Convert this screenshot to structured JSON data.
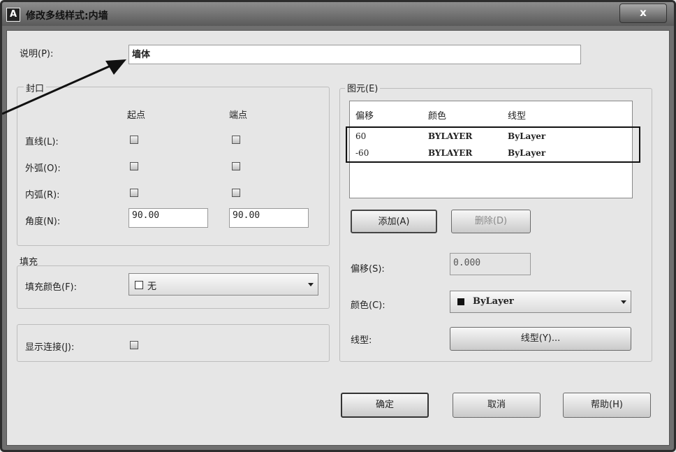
{
  "window": {
    "title": "修改多线样式:内墙",
    "close_label": "x"
  },
  "description": {
    "label": "说明(P):",
    "value": "墙体"
  },
  "caps": {
    "title": "封口",
    "col_start": "起点",
    "col_end": "端点",
    "rows": [
      {
        "label": "直线(L):"
      },
      {
        "label": "外弧(O):"
      },
      {
        "label": "内弧(R):"
      }
    ],
    "angle": {
      "label": "角度(N):",
      "start_value": "90.00",
      "end_value": "90.00"
    }
  },
  "fill": {
    "title": "填充",
    "color_label": "填充颜色(F):",
    "color_value": "无"
  },
  "joints": {
    "label": "显示连接(J):"
  },
  "elements": {
    "title": "图元(E)",
    "headers": [
      "偏移",
      "颜色",
      "线型"
    ],
    "rows": [
      {
        "offset": "60",
        "color": "BYLAYER",
        "linetype": "ByLayer"
      },
      {
        "offset": "-60",
        "color": "BYLAYER",
        "linetype": "ByLayer"
      }
    ],
    "add_label": "添加(A)",
    "delete_label": "删除(D)",
    "offset_label": "偏移(S):",
    "offset_value": "0.000",
    "color_label": "颜色(C):",
    "color_value": "ByLayer",
    "linetype_label": "线型:",
    "linetype_button": "线型(Y)..."
  },
  "buttons": {
    "ok": "确定",
    "cancel": "取消",
    "help": "帮助(H)"
  },
  "colors": {
    "titlebar": "#6f6f6f",
    "dialog_bg": "#e6e6e6",
    "highlight_box": "#111111"
  }
}
